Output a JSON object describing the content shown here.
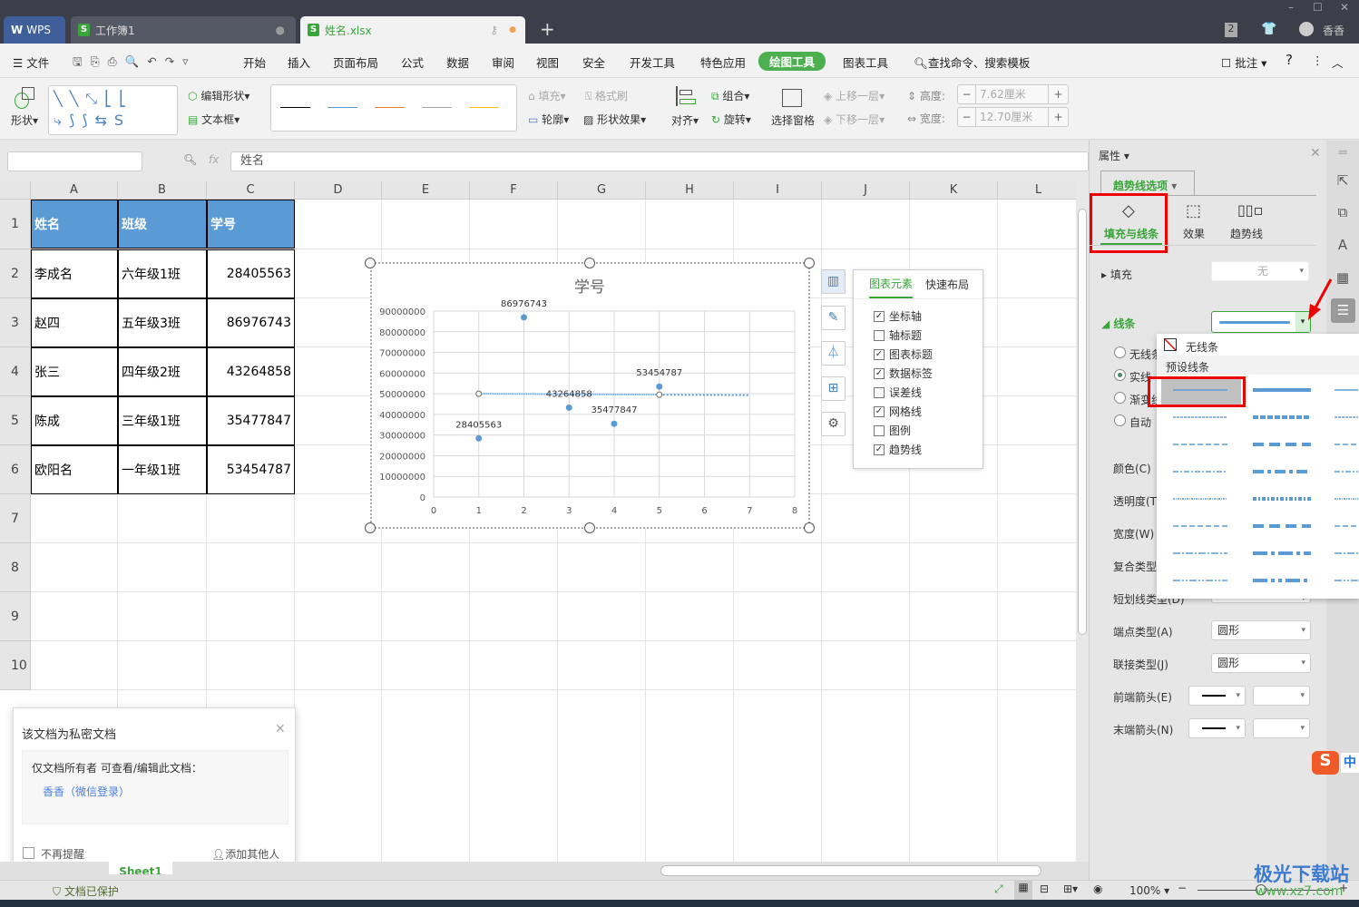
{
  "titlebar": {
    "wps": "WPS",
    "tabs": [
      {
        "label": "工作簿1"
      },
      {
        "label": "姓名.xlsx"
      }
    ],
    "new_tab": "+",
    "badge": "2",
    "user": "香香",
    "minimize": "–",
    "maximize": "☐",
    "close": "✕"
  },
  "menu": {
    "file": "文件",
    "items": [
      "开始",
      "插入",
      "页面布局",
      "公式",
      "数据",
      "审阅",
      "视图",
      "安全",
      "开发工具",
      "特色应用",
      "绘图工具",
      "图表工具"
    ],
    "search": "查找命令、搜索模板",
    "comment": "批注",
    "help": "?"
  },
  "ribbon": {
    "shape": "形状",
    "edit_shape": "编辑形状",
    "textbox": "文本框",
    "fill": "填充",
    "format_brush": "格式刷",
    "outline": "轮廓",
    "shape_effect": "形状效果",
    "align": "对齐",
    "group": "组合",
    "rotate": "旋转",
    "select_pane": "选择窗格",
    "bring_forward": "上移一层",
    "send_backward": "下移一层",
    "height_label": "高度:",
    "height_value": "7.62厘米",
    "width_label": "宽度:",
    "width_value": "12.70厘米",
    "line_colors": [
      "#000000",
      "#5b9bd5",
      "#ed7d31",
      "#a5a5a5",
      "#ffc000"
    ]
  },
  "formula": {
    "fx": "fx",
    "value": "姓名"
  },
  "columns": [
    "A",
    "B",
    "C",
    "D",
    "E",
    "F",
    "G",
    "H",
    "I",
    "J",
    "K",
    "L"
  ],
  "rows": [
    "1",
    "2",
    "3",
    "4",
    "5",
    "6",
    "7",
    "8",
    "9",
    "10"
  ],
  "table": {
    "headers": [
      "姓名",
      "班级",
      "学号"
    ],
    "data": [
      [
        "李成名",
        "六年级1班",
        "28405563"
      ],
      [
        "赵四",
        "五年级3班",
        "86976743"
      ],
      [
        "张三",
        "四年级2班",
        "43264858"
      ],
      [
        "陈成",
        "三年级1班",
        "35477847"
      ],
      [
        "欧阳名",
        "一年级1班",
        "53454787"
      ]
    ]
  },
  "chart_data": {
    "type": "scatter",
    "title": "学号",
    "x": [
      1,
      2,
      3,
      4,
      5
    ],
    "y": [
      28405563,
      86976743,
      43264858,
      35477847,
      53454787
    ],
    "data_labels": [
      "28405563",
      "86976743",
      "43264858",
      "35477847",
      "53454787"
    ],
    "xlim": [
      0,
      8
    ],
    "ylim": [
      0,
      90000000
    ],
    "xticks": [
      "0",
      "1",
      "2",
      "3",
      "4",
      "5",
      "6",
      "7",
      "8"
    ],
    "yticks": [
      "0",
      "10000000",
      "20000000",
      "30000000",
      "40000000",
      "50000000",
      "60000000",
      "70000000",
      "80000000",
      "90000000"
    ],
    "trendline": {
      "type": "linear",
      "from_x": 1,
      "to_x": 7,
      "y_start": 50000000,
      "y_end": 49300000,
      "color": "#5b9bd5"
    },
    "grid": true,
    "point_color": "#5b9bd5"
  },
  "chart_elements": {
    "tab1": "图表元素",
    "tab2": "快速布局",
    "items": [
      {
        "label": "坐标轴",
        "checked": true
      },
      {
        "label": "轴标题",
        "checked": false
      },
      {
        "label": "图表标题",
        "checked": true
      },
      {
        "label": "数据标签",
        "checked": true
      },
      {
        "label": "误差线",
        "checked": false
      },
      {
        "label": "网格线",
        "checked": true
      },
      {
        "label": "图例",
        "checked": false
      },
      {
        "label": "趋势线",
        "checked": true
      }
    ]
  },
  "panel": {
    "title": "属性",
    "section": "趋势线选项",
    "tabs": [
      "填充与线条",
      "效果",
      "趋势线"
    ],
    "fill_label": "填充",
    "fill_value": "无",
    "line_label": "线条",
    "radios": [
      "无线条",
      "实线",
      "渐变线",
      "自动"
    ],
    "props": [
      "颜色(C)",
      "透明度(T)",
      "宽度(W)",
      "复合类型",
      "短划线类型(D)",
      "端点类型(A)",
      "联接类型(J)",
      "前端箭头(E)",
      "末端箭头(N)"
    ],
    "cap_value": "圆形",
    "join_value": "圆形"
  },
  "dropdown": {
    "no_line": "无线条",
    "preset": "预设线条"
  },
  "popup": {
    "title": "该文档为私密文档",
    "desc": "仅文档所有者 可查看/编辑此文档：",
    "owner": "香香（微信登录）",
    "no_remind": "不再提醒",
    "add_others": "添加其他人"
  },
  "sheet_tab": "Sheet1",
  "status": {
    "protected": "文档已保护",
    "zoom": "100%"
  },
  "watermark": {
    "text": "极光下载站",
    "url": "www.xz7.com"
  },
  "ime": "中"
}
